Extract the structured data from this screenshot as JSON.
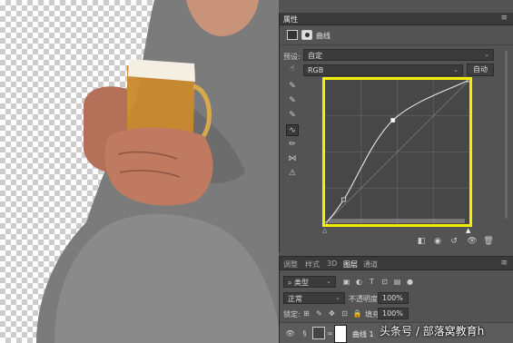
{
  "properties_panel": {
    "tab_label": "属性",
    "menu_glyph": "≡",
    "collapse_glyph": "««",
    "curve_name": "曲线",
    "preset_label": "预设:",
    "preset_value": "自定",
    "channel_value": "RGB",
    "auto_button": "自动",
    "tool_glyphs": [
      "✎",
      "✎",
      "✎",
      "∿",
      "✏",
      "⋈",
      "⚠"
    ],
    "bottom_glyphs": [
      "◧",
      "◉",
      "↺",
      "👁",
      "🗑"
    ]
  },
  "curve": {
    "points": [
      [
        0,
        0
      ],
      [
        0.13,
        0.17
      ],
      [
        0.47,
        0.72
      ],
      [
        1,
        1
      ]
    ],
    "color_frame": "#f2ef00"
  },
  "layers_panel": {
    "tabs": [
      "调整",
      "样式",
      "3D",
      "图层",
      "通道"
    ],
    "active_tab": "图层",
    "kind_filter": "类型",
    "blend_mode": "正常",
    "opacity_label": "不透明度:",
    "opacity_value": "100%",
    "lock_label": "锁定:",
    "fill_label": "填充:",
    "fill_value": "100%",
    "layer_name": "曲线 1"
  },
  "watermark": "头条号 / 部落窝教育h"
}
